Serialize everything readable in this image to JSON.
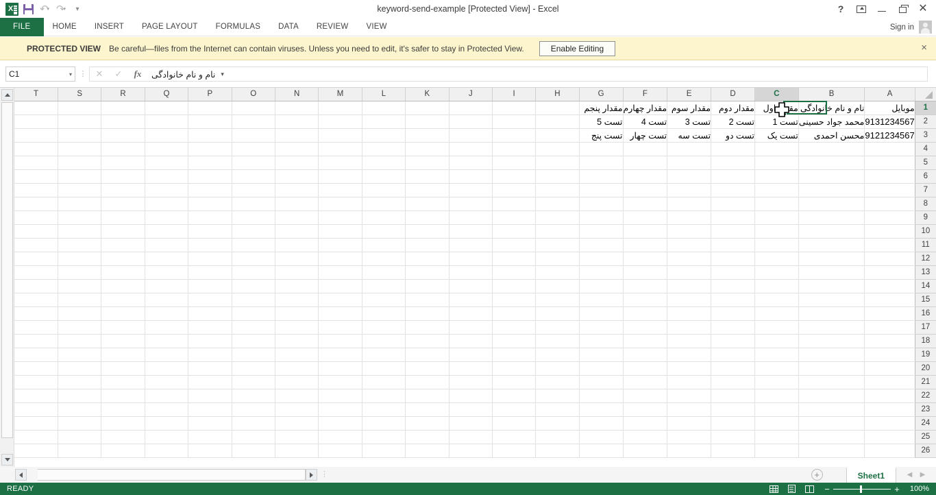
{
  "window": {
    "title": "keyword-send-example  [Protected View] - Excel",
    "quick_access": [
      {
        "name": "excel-logo-icon",
        "label": "Excel"
      },
      {
        "name": "save-icon",
        "label": "Save"
      },
      {
        "name": "undo-icon",
        "label": "Undo"
      },
      {
        "name": "redo-icon",
        "label": "Redo"
      },
      {
        "name": "customize-quick-access-icon",
        "label": "Customize Quick Access Toolbar"
      }
    ],
    "controls": [
      {
        "name": "help-button",
        "label": "?"
      },
      {
        "name": "ribbon-display-options-button",
        "label": "Ribbon Display Options"
      },
      {
        "name": "minimize-button",
        "label": "Minimize"
      },
      {
        "name": "restore-button",
        "label": "Restore Down"
      },
      {
        "name": "close-button",
        "label": "×"
      }
    ]
  },
  "ribbon": {
    "tabs": [
      {
        "label": "FILE",
        "active": true
      },
      {
        "label": "HOME",
        "active": false
      },
      {
        "label": "INSERT",
        "active": false
      },
      {
        "label": "PAGE LAYOUT",
        "active": false
      },
      {
        "label": "FORMULAS",
        "active": false
      },
      {
        "label": "DATA",
        "active": false
      },
      {
        "label": "REVIEW",
        "active": false
      },
      {
        "label": "VIEW",
        "active": false
      }
    ],
    "sign_in": "Sign in"
  },
  "protected_view": {
    "label": "PROTECTED VIEW",
    "message": "Be careful—files from the Internet can contain viruses. Unless you need to edit, it's safer to stay in Protected View.",
    "button": "Enable Editing",
    "close": "×"
  },
  "formula_bar": {
    "name_box": "C1",
    "name_box_caret": "▾",
    "cancel": "✕",
    "enter": "✓",
    "insert_function": "fx",
    "value": "نام و نام خانوادگی",
    "dropdown": "▾"
  },
  "grid": {
    "columns": [
      "T",
      "S",
      "R",
      "Q",
      "P",
      "O",
      "N",
      "M",
      "L",
      "K",
      "J",
      "I",
      "H",
      "G",
      "F",
      "E",
      "D",
      "C",
      "B",
      "A"
    ],
    "selected_column": "C",
    "selected_row": 1,
    "row_count": 26,
    "rows": [
      {
        "n": 1,
        "cells": {
          "A": "موبایل",
          "B": "نام و نام خانوادگی",
          "C": "مقدار اول",
          "D": "مقدار دوم",
          "E": "مقدار سوم",
          "F": "مقدار چهارم",
          "G": "مقدار پنجم"
        }
      },
      {
        "n": 2,
        "cells": {
          "A": "9131234567",
          "B": "محمد جواد حسینی",
          "C": "تست 1",
          "D": "تست 2",
          "E": "تست 3",
          "F": "تست 4",
          "G": "تست 5"
        }
      },
      {
        "n": 3,
        "cells": {
          "A": "9121234567",
          "B": "محسن احمدی",
          "C": "تست یک",
          "D": "تست دو",
          "E": "تست سه",
          "F": "تست چهار",
          "G": "تست پنج"
        }
      }
    ]
  },
  "sheet_bar": {
    "scroll_left": "◀",
    "scroll_right": "▶",
    "add_sheet": "+",
    "tabs": [
      {
        "label": "Sheet1",
        "active": true
      }
    ],
    "nav_prev": "◀",
    "nav_next": "▶"
  },
  "status_bar": {
    "state": "READY",
    "view_modes": [
      {
        "name": "normal-view-icon",
        "label": "Normal"
      },
      {
        "name": "page-layout-view-icon",
        "label": "Page Layout"
      },
      {
        "name": "page-break-preview-icon",
        "label": "Page Break Preview"
      }
    ],
    "zoom_out": "−",
    "zoom_in": "+",
    "zoom_level": "100%"
  },
  "colors": {
    "accent_green": "#1d7044",
    "protected_bar": "#fdf5cd",
    "header_gray": "#f0f0f0"
  }
}
